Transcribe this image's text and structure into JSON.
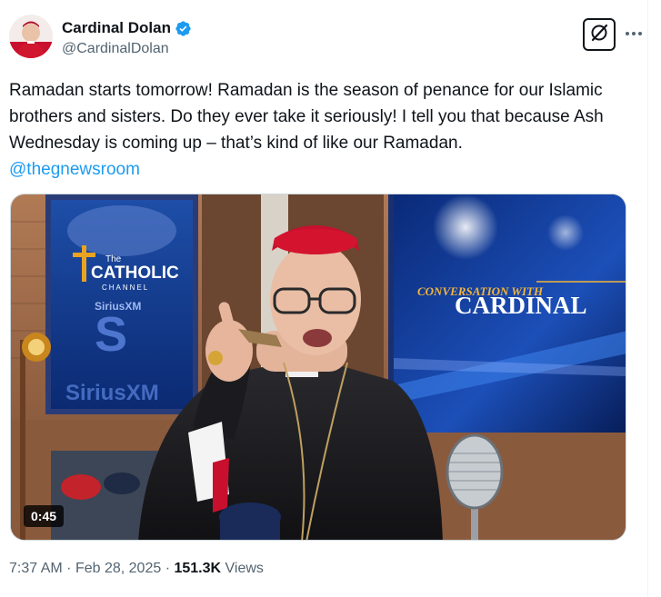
{
  "author": {
    "display_name": "Cardinal Dolan",
    "handle": "@CardinalDolan",
    "verified": true
  },
  "tweet": {
    "text": "Ramadan starts tomorrow! Ramadan is the season of penance for our Islamic brothers and sisters. Do they ever take it seriously! I tell you that because Ash Wednesday is coming up – that’s kind of like our Ramadan.",
    "mention": "@thegnewsroom"
  },
  "media": {
    "duration": "0:45",
    "set_text": {
      "network_top": "The",
      "network_name": "CATHOLIC",
      "network_sub": "CHANNEL",
      "sirius_small": "SiriusXM",
      "sirius_big": "SiriusXM",
      "show_top": "CONVERSATION WITH",
      "show_main": "CARDINAL"
    }
  },
  "meta": {
    "time": "7:37 AM",
    "separator": "·",
    "date": "Feb 28, 2025",
    "views_count": "151.3K",
    "views_label": "Views"
  },
  "colors": {
    "link": "#1d9bf0",
    "verified": "#1d9bf0",
    "secondary_text": "#536471"
  },
  "icons": {
    "verified": "verified-badge-icon",
    "grok": "grok-icon",
    "more": "more-dots-icon"
  }
}
